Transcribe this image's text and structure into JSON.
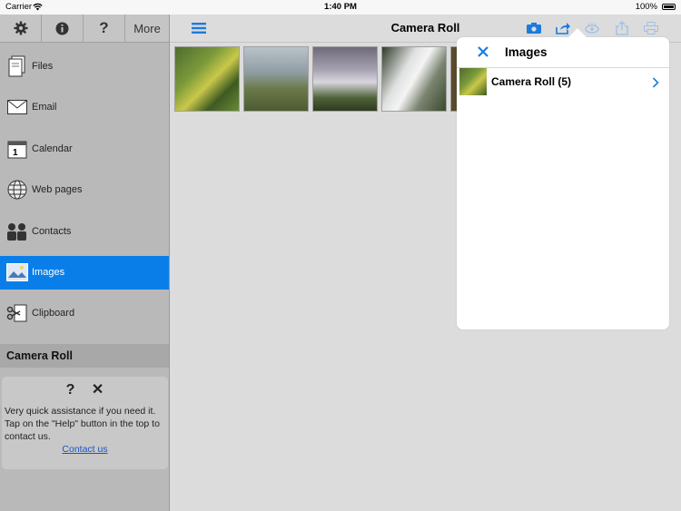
{
  "status": {
    "carrier": "Carrier",
    "time": "1:40 PM",
    "battery": "100%"
  },
  "sidebar": {
    "top": {
      "settings_icon": "gear-icon",
      "info_icon": "info-icon",
      "help_icon": "question-icon",
      "more_label": "More"
    },
    "items": [
      {
        "label": "Files",
        "icon": "files-icon"
      },
      {
        "label": "Email",
        "icon": "envelope-icon"
      },
      {
        "label": "Calendar",
        "icon": "calendar-icon"
      },
      {
        "label": "Web pages",
        "icon": "globe-icon"
      },
      {
        "label": "Contacts",
        "icon": "contacts-icon"
      },
      {
        "label": "Images",
        "icon": "image-icon",
        "selected": true
      },
      {
        "label": "Clipboard",
        "icon": "clipboard-icon"
      }
    ],
    "section_title": "Camera Roll",
    "help": {
      "text": "Very quick assistance if you need it. Tap on the \"Help\" button in the top to contact us.",
      "link": "Contact us"
    }
  },
  "header": {
    "title": "Camera Roll",
    "accent": "#1a7be0"
  },
  "popover": {
    "title": "Images",
    "rows": [
      {
        "label": "Camera Roll (5)"
      }
    ]
  }
}
